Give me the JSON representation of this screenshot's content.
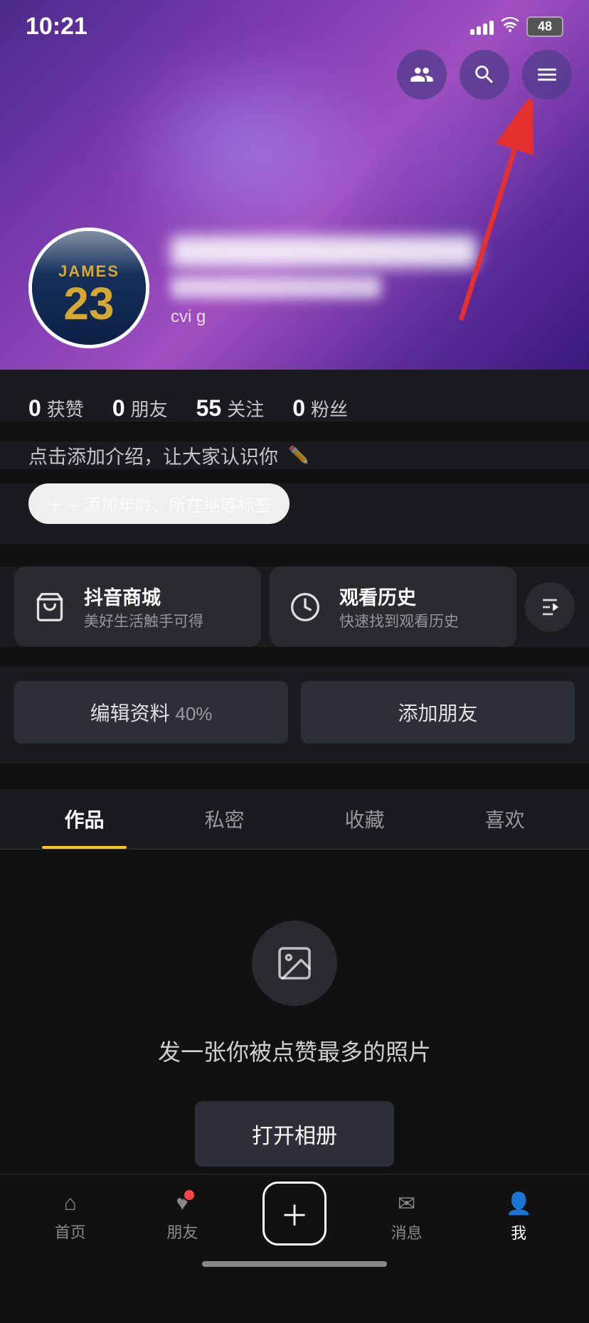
{
  "statusBar": {
    "time": "10:21",
    "battery": "48"
  },
  "topIcons": {
    "friends": "friends-icon",
    "search": "search-icon",
    "menu": "menu-icon"
  },
  "profile": {
    "avatarName": "JAMES 23",
    "usernameBlurred": true,
    "stats": [
      {
        "num": "0",
        "label": "获赞"
      },
      {
        "num": "0",
        "label": "朋友"
      },
      {
        "num": "55",
        "label": "关注"
      },
      {
        "num": "0",
        "label": "粉丝"
      }
    ],
    "bioPlaceholder": "点击添加介绍，让大家认识你",
    "tagPlaceholder": "+ 添加年龄、所在地等标签",
    "features": [
      {
        "icon": "cart",
        "title": "抖音商城",
        "sub": "美好生活触手可得"
      },
      {
        "icon": "clock",
        "title": "观看历史",
        "sub": "快速找到观看历史"
      }
    ],
    "editProfileLabel": "编辑资料 40%",
    "addFriendLabel": "添加朋友",
    "tabs": [
      {
        "label": "作品",
        "active": true
      },
      {
        "label": "私密",
        "active": false
      },
      {
        "label": "收藏",
        "active": false
      },
      {
        "label": "喜欢",
        "active": false
      }
    ],
    "emptyState": {
      "text": "发一张你被点赞最多的照片",
      "buttonLabel": "打开相册"
    }
  },
  "bottomNav": {
    "items": [
      {
        "label": "首页",
        "active": false
      },
      {
        "label": "朋友",
        "active": false,
        "dot": true
      },
      {
        "label": "",
        "active": false,
        "plus": true
      },
      {
        "label": "消息",
        "active": false
      },
      {
        "label": "我",
        "active": true
      }
    ]
  }
}
